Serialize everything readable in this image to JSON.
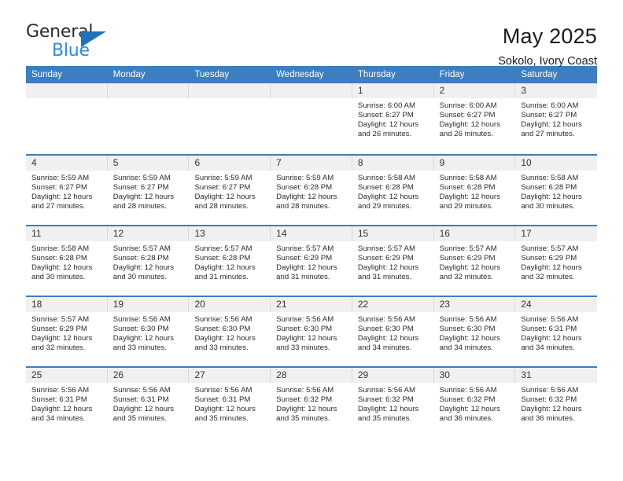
{
  "brand": {
    "name_top": "General",
    "name_bottom": "Blue",
    "accent_color": "#1f72bd",
    "accent_color_light": "#2e8bd4"
  },
  "header": {
    "title": "May 2025",
    "location": "Sokolo, Ivory Coast"
  },
  "theme": {
    "header_bar_color": "#3c7ebf",
    "date_band_color": "#f0f0f0",
    "text_color": "#2b2b2b"
  },
  "calendar": {
    "weekdays": [
      "Sunday",
      "Monday",
      "Tuesday",
      "Wednesday",
      "Thursday",
      "Friday",
      "Saturday"
    ],
    "labels": {
      "sunrise": "Sunrise:",
      "sunset": "Sunset:",
      "daylight": "Daylight:"
    },
    "weeks": [
      [
        {
          "day": "",
          "empty": true
        },
        {
          "day": "",
          "empty": true
        },
        {
          "day": "",
          "empty": true
        },
        {
          "day": "",
          "empty": true
        },
        {
          "day": "1",
          "sunrise": "Sunrise: 6:00 AM",
          "sunset": "Sunset: 6:27 PM",
          "daylight": "Daylight: 12 hours and 26 minutes."
        },
        {
          "day": "2",
          "sunrise": "Sunrise: 6:00 AM",
          "sunset": "Sunset: 6:27 PM",
          "daylight": "Daylight: 12 hours and 26 minutes."
        },
        {
          "day": "3",
          "sunrise": "Sunrise: 6:00 AM",
          "sunset": "Sunset: 6:27 PM",
          "daylight": "Daylight: 12 hours and 27 minutes."
        }
      ],
      [
        {
          "day": "4",
          "sunrise": "Sunrise: 5:59 AM",
          "sunset": "Sunset: 6:27 PM",
          "daylight": "Daylight: 12 hours and 27 minutes."
        },
        {
          "day": "5",
          "sunrise": "Sunrise: 5:59 AM",
          "sunset": "Sunset: 6:27 PM",
          "daylight": "Daylight: 12 hours and 28 minutes."
        },
        {
          "day": "6",
          "sunrise": "Sunrise: 5:59 AM",
          "sunset": "Sunset: 6:27 PM",
          "daylight": "Daylight: 12 hours and 28 minutes."
        },
        {
          "day": "7",
          "sunrise": "Sunrise: 5:59 AM",
          "sunset": "Sunset: 6:28 PM",
          "daylight": "Daylight: 12 hours and 28 minutes."
        },
        {
          "day": "8",
          "sunrise": "Sunrise: 5:58 AM",
          "sunset": "Sunset: 6:28 PM",
          "daylight": "Daylight: 12 hours and 29 minutes."
        },
        {
          "day": "9",
          "sunrise": "Sunrise: 5:58 AM",
          "sunset": "Sunset: 6:28 PM",
          "daylight": "Daylight: 12 hours and 29 minutes."
        },
        {
          "day": "10",
          "sunrise": "Sunrise: 5:58 AM",
          "sunset": "Sunset: 6:28 PM",
          "daylight": "Daylight: 12 hours and 30 minutes."
        }
      ],
      [
        {
          "day": "11",
          "sunrise": "Sunrise: 5:58 AM",
          "sunset": "Sunset: 6:28 PM",
          "daylight": "Daylight: 12 hours and 30 minutes."
        },
        {
          "day": "12",
          "sunrise": "Sunrise: 5:57 AM",
          "sunset": "Sunset: 6:28 PM",
          "daylight": "Daylight: 12 hours and 30 minutes."
        },
        {
          "day": "13",
          "sunrise": "Sunrise: 5:57 AM",
          "sunset": "Sunset: 6:28 PM",
          "daylight": "Daylight: 12 hours and 31 minutes."
        },
        {
          "day": "14",
          "sunrise": "Sunrise: 5:57 AM",
          "sunset": "Sunset: 6:29 PM",
          "daylight": "Daylight: 12 hours and 31 minutes."
        },
        {
          "day": "15",
          "sunrise": "Sunrise: 5:57 AM",
          "sunset": "Sunset: 6:29 PM",
          "daylight": "Daylight: 12 hours and 31 minutes."
        },
        {
          "day": "16",
          "sunrise": "Sunrise: 5:57 AM",
          "sunset": "Sunset: 6:29 PM",
          "daylight": "Daylight: 12 hours and 32 minutes."
        },
        {
          "day": "17",
          "sunrise": "Sunrise: 5:57 AM",
          "sunset": "Sunset: 6:29 PM",
          "daylight": "Daylight: 12 hours and 32 minutes."
        }
      ],
      [
        {
          "day": "18",
          "sunrise": "Sunrise: 5:57 AM",
          "sunset": "Sunset: 6:29 PM",
          "daylight": "Daylight: 12 hours and 32 minutes."
        },
        {
          "day": "19",
          "sunrise": "Sunrise: 5:56 AM",
          "sunset": "Sunset: 6:30 PM",
          "daylight": "Daylight: 12 hours and 33 minutes."
        },
        {
          "day": "20",
          "sunrise": "Sunrise: 5:56 AM",
          "sunset": "Sunset: 6:30 PM",
          "daylight": "Daylight: 12 hours and 33 minutes."
        },
        {
          "day": "21",
          "sunrise": "Sunrise: 5:56 AM",
          "sunset": "Sunset: 6:30 PM",
          "daylight": "Daylight: 12 hours and 33 minutes."
        },
        {
          "day": "22",
          "sunrise": "Sunrise: 5:56 AM",
          "sunset": "Sunset: 6:30 PM",
          "daylight": "Daylight: 12 hours and 34 minutes."
        },
        {
          "day": "23",
          "sunrise": "Sunrise: 5:56 AM",
          "sunset": "Sunset: 6:30 PM",
          "daylight": "Daylight: 12 hours and 34 minutes."
        },
        {
          "day": "24",
          "sunrise": "Sunrise: 5:56 AM",
          "sunset": "Sunset: 6:31 PM",
          "daylight": "Daylight: 12 hours and 34 minutes."
        }
      ],
      [
        {
          "day": "25",
          "sunrise": "Sunrise: 5:56 AM",
          "sunset": "Sunset: 6:31 PM",
          "daylight": "Daylight: 12 hours and 34 minutes."
        },
        {
          "day": "26",
          "sunrise": "Sunrise: 5:56 AM",
          "sunset": "Sunset: 6:31 PM",
          "daylight": "Daylight: 12 hours and 35 minutes."
        },
        {
          "day": "27",
          "sunrise": "Sunrise: 5:56 AM",
          "sunset": "Sunset: 6:31 PM",
          "daylight": "Daylight: 12 hours and 35 minutes."
        },
        {
          "day": "28",
          "sunrise": "Sunrise: 5:56 AM",
          "sunset": "Sunset: 6:32 PM",
          "daylight": "Daylight: 12 hours and 35 minutes."
        },
        {
          "day": "29",
          "sunrise": "Sunrise: 5:56 AM",
          "sunset": "Sunset: 6:32 PM",
          "daylight": "Daylight: 12 hours and 35 minutes."
        },
        {
          "day": "30",
          "sunrise": "Sunrise: 5:56 AM",
          "sunset": "Sunset: 6:32 PM",
          "daylight": "Daylight: 12 hours and 36 minutes."
        },
        {
          "day": "31",
          "sunrise": "Sunrise: 5:56 AM",
          "sunset": "Sunset: 6:32 PM",
          "daylight": "Daylight: 12 hours and 36 minutes."
        }
      ]
    ]
  }
}
